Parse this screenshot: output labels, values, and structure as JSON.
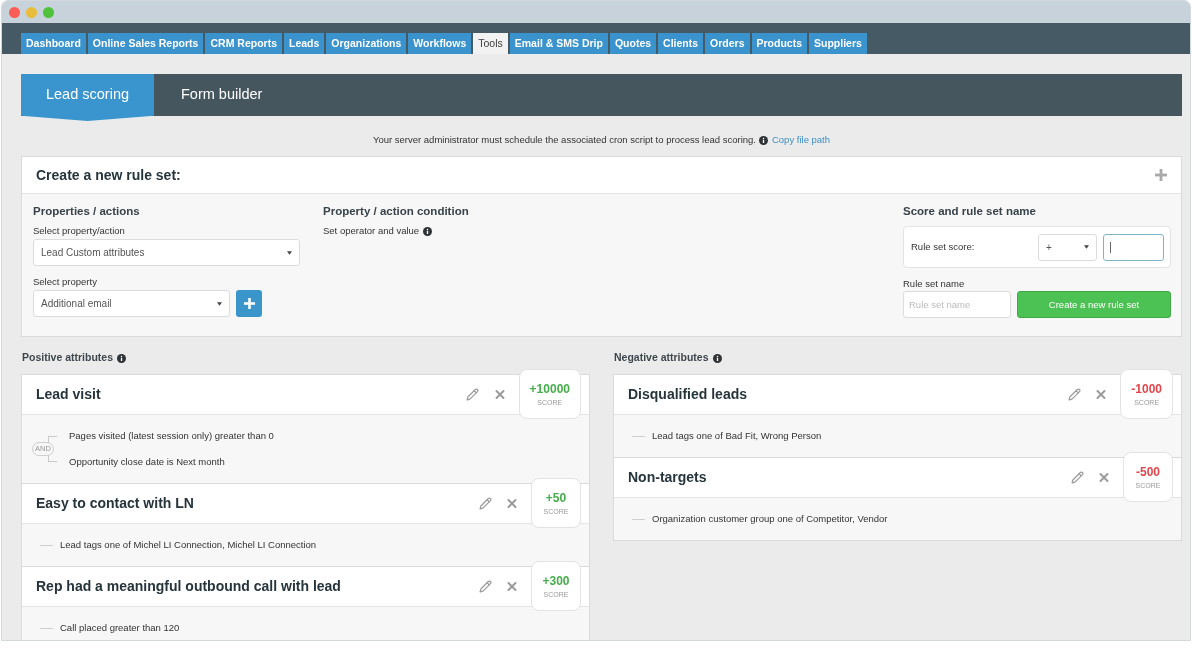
{
  "nav_tabs": [
    {
      "label": "Dashboard",
      "selected": false
    },
    {
      "label": "Online Sales Reports",
      "selected": false
    },
    {
      "label": "CRM Reports",
      "selected": false
    },
    {
      "label": "Leads",
      "selected": false
    },
    {
      "label": "Organizations",
      "selected": false
    },
    {
      "label": "Workflows",
      "selected": false
    },
    {
      "label": "Tools",
      "selected": true
    },
    {
      "label": "Email & SMS Drip",
      "selected": false
    },
    {
      "label": "Quotes",
      "selected": false
    },
    {
      "label": "Clients",
      "selected": false
    },
    {
      "label": "Orders",
      "selected": false
    },
    {
      "label": "Products",
      "selected": false
    },
    {
      "label": "Suppliers",
      "selected": false
    }
  ],
  "sub_tabs": [
    {
      "label": "Lead scoring",
      "selected": true
    },
    {
      "label": "Form builder",
      "selected": false
    }
  ],
  "notice": {
    "text": "Your server administrator must schedule the associated cron script to process lead scoring.",
    "link": "Copy file path"
  },
  "rule_set_form": {
    "title": "Create a new rule set:",
    "properties": {
      "heading": "Properties / actions",
      "fields": [
        {
          "label": "Select property/action",
          "value": "Lead Custom attributes",
          "add_button": false
        },
        {
          "label": "Select property",
          "value": "Additional email",
          "add_button": true
        }
      ]
    },
    "condition": {
      "heading": "Property / action condition",
      "hint": "Set operator and value"
    },
    "score": {
      "heading": "Score and rule set name",
      "score_label": "Rule set score:",
      "sign": "+",
      "score_focused": true,
      "name_label": "Rule set name",
      "name_placeholder": "Rule set name",
      "submit": "Create a new rule set"
    }
  },
  "attribute_sections": [
    {
      "kind": "positive",
      "heading": "Positive attributes",
      "rules": [
        {
          "title": "Lead visit",
          "score": "+10000",
          "score_caption": "SCORE",
          "operator": "AND",
          "conditions": [
            "Pages visited (latest session only) greater than 0",
            "Opportunity close date is Next month"
          ]
        },
        {
          "title": "Easy to contact with LN",
          "score": "+50",
          "score_caption": "SCORE",
          "conditions": [
            "Lead tags one of Michel LI Connection, Michel LI Connection"
          ]
        },
        {
          "title": "Rep had a meaningful outbound call with lead",
          "score": "+300",
          "score_caption": "SCORE",
          "conditions": [
            "Call placed greater than 120"
          ]
        }
      ]
    },
    {
      "kind": "negative",
      "heading": "Negative attributes",
      "rules": [
        {
          "title": "Disqualified leads",
          "score": "-1000",
          "score_caption": "SCORE",
          "conditions": [
            "Lead tags one of Bad Fit, Wrong Person"
          ]
        },
        {
          "title": "Non-targets",
          "score": "-500",
          "score_caption": "SCORE",
          "conditions": [
            "Organization customer group one of Competitor, Vendor"
          ]
        }
      ]
    }
  ]
}
